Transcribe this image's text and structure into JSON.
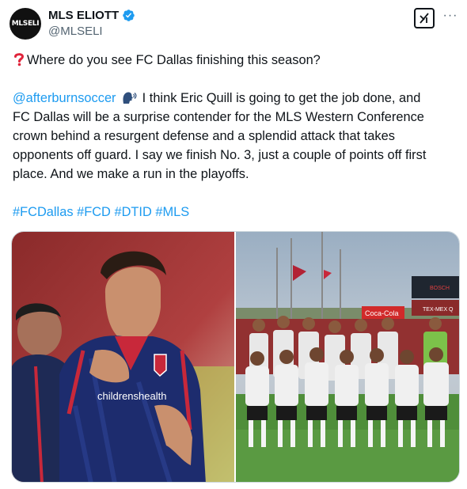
{
  "author": {
    "avatar_text": "MLSELI",
    "display_name": "MLS ELIOTT",
    "handle": "@MLSELI"
  },
  "icons": {
    "verified": "verified-badge-icon",
    "grok": "grok-icon",
    "more": "more-options-icon",
    "question": "red-question-mark-icon",
    "speaker": "speaking-head-icon"
  },
  "tweet": {
    "question": "Where do you see FC Dallas finishing this season?",
    "mention": "@afterburnsoccer",
    "line1_rest": "I think Eric Quill is going to get the job done, and",
    "line2": "FC Dallas will be a surprise contender for the MLS Western Conference",
    "line3": "crown behind a resurgent defense and a splendid attack that takes",
    "line4": "opponents off guard. I say we finish No. 3, just a couple of points off first",
    "line5": "place. And we make a run in the playoffs.",
    "hashtags": [
      "#FCDallas",
      "#FCD",
      "#DTID",
      "#MLS"
    ]
  },
  "media": {
    "left_photo_text": "childrenshealth",
    "right_signs": [
      "BOSCH",
      "Coca-Cola",
      "TEX-MEX Q"
    ]
  },
  "colors": {
    "link": "#1d9bf0",
    "verified": "#1d9bf0",
    "handle": "#536471"
  }
}
